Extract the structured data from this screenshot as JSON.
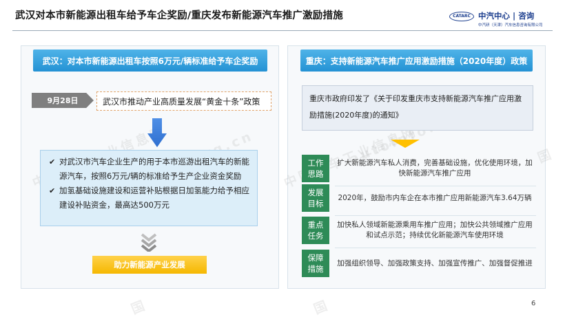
{
  "header": {
    "title": "武汉对本市新能源出租车给予车企奖励/重庆发布新能源汽车推广激励措施",
    "logo_mark": "CATARC",
    "logo_name": "中汽中心 | 咨询",
    "logo_sub": "中汽研（天津）汽车信息咨询有限公司"
  },
  "left": {
    "banner": "武汉：对本市新能源出租车按照6万元/辆标准给予车企奖励",
    "date_tag": "9月28日",
    "policy": "武汉市推动产业高质量发展“黄金十条”政策",
    "bullets": [
      "对武汉市汽车企业生产的用于本市巡游出租汽车的新能源汽车，按照6万元/辆的标准给予生产企业资金奖励",
      "加氢基础设施建设和运营补贴根据日加氢能力给予相应建设补贴资金，最高达500万元"
    ],
    "cta": "助力新能源产业发展"
  },
  "right": {
    "banner": "重庆：支持新能源汽车推广应用激励措施（2020年度）政策",
    "notice": "重庆市政府印发了《关于印发重庆市支持新能源汽车推广应用激励措施(2020年度)的通知》",
    "rows": [
      {
        "tag": "工作思路",
        "text": "扩大新能源汽车私人消费，完善基础设施，优化使用环境，加快新能源汽车推广应用"
      },
      {
        "tag": "发展目标",
        "text": "2020年，鼓励市内车企在本市推广应用新能源汽车3.64万辆"
      },
      {
        "tag": "重点任务",
        "text": "加快私人领域新能源乘用车推广应用；加快公共领域推广应用和试点示范；持续优化新能源汽车使用环境"
      },
      {
        "tag": "保障措施",
        "text": "加强组织领导、加强政策支持、加强宣传推广、加强督促推进"
      }
    ]
  },
  "watermark": {
    "cn": "中国汽车工业信息网",
    "url": "autoinfo.org.cn",
    "short": "国"
  },
  "page_number": "6",
  "colors": {
    "banner": "#2492d4",
    "tag_green": "#2e8b57",
    "cta_yellow": "#f5b800",
    "arrow_blue": "#2f6fd0",
    "date_gray": "#7f7f7f"
  }
}
